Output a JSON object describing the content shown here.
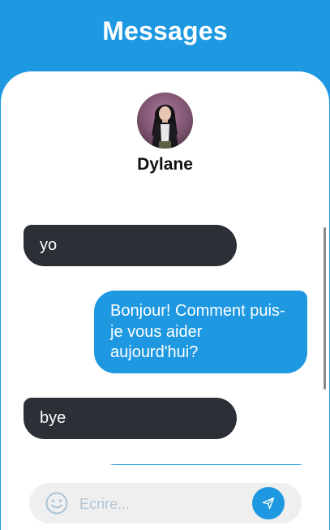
{
  "header": {
    "title": "Messages"
  },
  "contact": {
    "name": "Dylane"
  },
  "messages": [
    {
      "from": "contact",
      "text": "yo"
    },
    {
      "from": "me",
      "text": "Bonjour! Comment puis-je vous aider aujourd'hui?"
    },
    {
      "from": "contact",
      "text": "bye"
    },
    {
      "from": "me",
      "text": ""
    }
  ],
  "composer": {
    "placeholder": "Ecrire..."
  },
  "icons": {
    "emoji": "smiley-icon",
    "send": "paper-plane-icon"
  },
  "colors": {
    "accent": "#1d98e1",
    "received_bubble": "#2b3036",
    "input_bg": "#efefef"
  }
}
